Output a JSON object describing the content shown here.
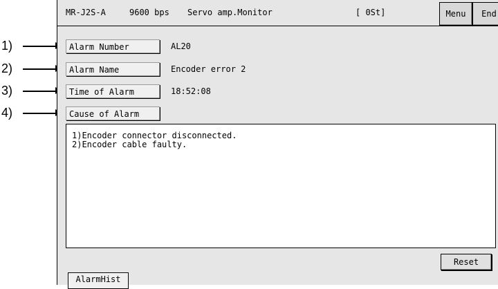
{
  "annotations": [
    "1)",
    "2)",
    "3)",
    "4)"
  ],
  "header": {
    "model": "MR-J2S-A",
    "baud": "9600 bps",
    "title": "Servo amp.Monitor",
    "station": "[ 0St]",
    "menu_label": "Menu",
    "end_label": "End"
  },
  "fields": {
    "alarm_number": {
      "label": "Alarm Number",
      "value": "AL20"
    },
    "alarm_name": {
      "label": "Alarm Name",
      "value": "Encoder error 2"
    },
    "time_of_alarm": {
      "label": "Time of Alarm",
      "value": "18:52:08"
    },
    "cause_of_alarm": {
      "label": "Cause of Alarm"
    }
  },
  "cause_lines": [
    "1)Encoder connector disconnected.",
    "2)Encoder cable faulty."
  ],
  "buttons": {
    "reset": "Reset",
    "alarm_hist": "AlarmHist"
  },
  "icons": {
    "pointer": "right-arrow-icon"
  }
}
